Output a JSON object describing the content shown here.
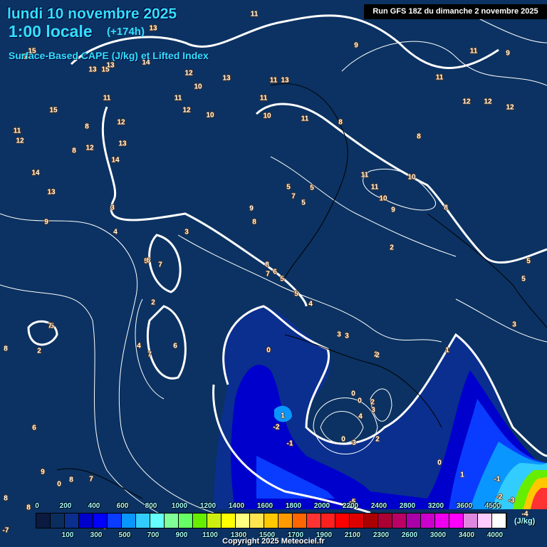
{
  "header": {
    "date": "lundi 10 novembre 2025",
    "time": "1:00 locale",
    "lead": "(+174h)",
    "parameter": "Surface-Based CAPE (J/kg) et Lifted Index",
    "run": "Run GFS 18Z du dimanche 2 novembre 2025"
  },
  "colors": {
    "background": "#0b3262",
    "contour": "#ffffff",
    "title": "#33e0ff"
  },
  "legend": {
    "unit": "(J/kg)",
    "top_ticks": [
      "0",
      "200",
      "400",
      "600",
      "800",
      "1000",
      "1200",
      "1400",
      "1600",
      "1800",
      "2000",
      "2200",
      "2400",
      "2800",
      "3200",
      "3600",
      "4500"
    ],
    "bottom_ticks": [
      "100",
      "300",
      "500",
      "700",
      "900",
      "1100",
      "1300",
      "1500",
      "1700",
      "1900",
      "2100",
      "2300",
      "2600",
      "3000",
      "3400",
      "4000"
    ],
    "colors": [
      "#0a1a40",
      "#0b2d5e",
      "#0a2f8f",
      "#0000cc",
      "#0000ff",
      "#0a3cff",
      "#0a96ff",
      "#33ccff",
      "#66ffff",
      "#80ff99",
      "#66ff66",
      "#66ee00",
      "#ccee11",
      "#ffff00",
      "#ffff80",
      "#ffe650",
      "#ffc800",
      "#ff9900",
      "#ff6600",
      "#ff3333",
      "#ff2020",
      "#ff0000",
      "#dd0000",
      "#aa0000",
      "#aa0033",
      "#bb0066",
      "#aa00aa",
      "#cc00cc",
      "#ee00ee",
      "#ff00ff",
      "#dd88dd",
      "#ffccff",
      "#ffffff"
    ]
  },
  "lifted_index_labels": [
    "14",
    "15",
    "15",
    "15",
    "13",
    "14",
    "13",
    "13",
    "11",
    "12",
    "11",
    "11",
    "12",
    "10",
    "10",
    "13",
    "11",
    "12",
    "13",
    "11",
    "11",
    "10",
    "9",
    "11",
    "9",
    "11",
    "12",
    "12",
    "12",
    "8",
    "8",
    "8",
    "13",
    "14",
    "8",
    "12",
    "13",
    "14",
    "11",
    "12",
    "9",
    "3",
    "4",
    "3",
    "5",
    "7",
    "2",
    "4",
    "7",
    "6",
    "2",
    "5",
    "5",
    "7",
    "5",
    "8",
    "9",
    "8",
    "7",
    "6",
    "5",
    "5",
    "4",
    "3",
    "5",
    "5",
    "11",
    "11",
    "10",
    "10",
    "9",
    "8",
    "2",
    "5",
    "6",
    "3",
    "1",
    "2",
    "3",
    "2",
    "0",
    "0",
    "0",
    "2",
    "3",
    "4",
    "1",
    "-2",
    "-1",
    "0",
    "3",
    "2",
    "0",
    "1",
    "-1",
    "-2",
    "-3",
    "-4",
    "-5",
    "-7",
    "0",
    "8",
    "8",
    "8",
    "9",
    "8",
    "7",
    "6",
    "8",
    "7",
    "5"
  ],
  "copyright": "Copyright 2025 Meteociel.fr"
}
